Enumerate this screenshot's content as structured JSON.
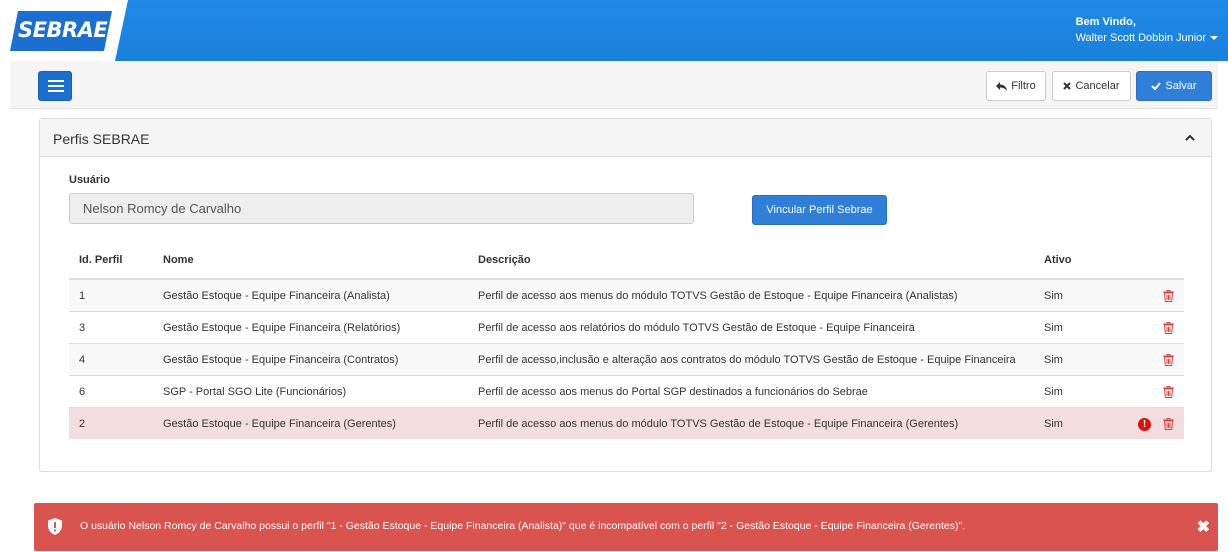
{
  "header": {
    "logo_text": "SEBRAE",
    "welcome_label": "Bem Vindo,",
    "user_name": "Walter Scott Dobbin Junior"
  },
  "toolbar": {
    "filtro_label": "Filtro",
    "cancelar_label": "Cancelar",
    "salvar_label": "Salvar"
  },
  "panel": {
    "title": "Perfis SEBRAE",
    "usuario_label": "Usuário",
    "usuario_value": "Nelson Romcy de Carvalho",
    "vincular_label": "Vincular Perfil Sebrae"
  },
  "table": {
    "headers": {
      "id": "Id. Perfil",
      "nome": "Nome",
      "descricao": "Descrição",
      "ativo": "Ativo"
    },
    "rows": [
      {
        "id": "1",
        "nome": "Gestão Estoque - Equipe Financeira (Analista)",
        "descricao": "Perfil de acesso aos menus do módulo TOTVS Gestão de Estoque - Equipe Financeira (Analistas)",
        "ativo": "Sim"
      },
      {
        "id": "3",
        "nome": "Gestão Estoque - Equipe Financeira (Relatórios)",
        "descricao": "Perfil de acesso aos relatórios do módulo TOTVS Gestão de Estoque - Equipe Financeira",
        "ativo": "Sim"
      },
      {
        "id": "4",
        "nome": "Gestão Estoque - Equipe Financeira (Contratos)",
        "descricao": "Perfil de acesso,inclusão e alteração aos contratos do módulo TOTVS Gestão de Estoque - Equipe Financeira",
        "ativo": "Sim"
      },
      {
        "id": "6",
        "nome": "SGP - Portal SGO Lite (Funcionários)",
        "descricao": "Perfil de acesso aos menus do Portal SGP destinados a funcionários do Sebrae",
        "ativo": "Sim"
      },
      {
        "id": "2",
        "nome": "Gestão Estoque - Equipe Financeira (Gerentes)",
        "descricao": "Perfil de acesso aos menus do módulo TOTVS Gestão de Estoque - Equipe Financeira (Gerentes)",
        "ativo": "Sim"
      }
    ]
  },
  "alert": {
    "message": "O usuário Nelson Romcy de Carvalho possui o perfil \"1 - Gestão Estoque - Equipe Financeira (Analista)\" que é incompatível com o perfil \"2 - Gestão Estoque - Equipe Financeira (Gerentes)\".",
    "close_symbol": "✖"
  },
  "colors": {
    "header_blue": "#1e88e5",
    "primary_button": "#2f7fd8",
    "danger_row": "#f2dede",
    "alert_red": "#d9534f",
    "trash_red": "#e0403c"
  }
}
